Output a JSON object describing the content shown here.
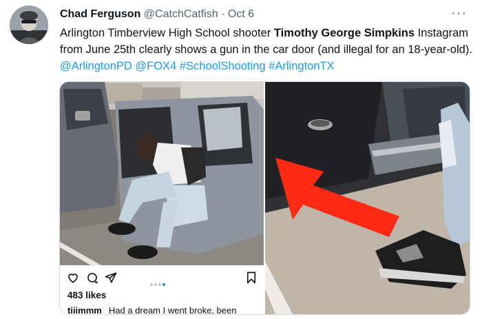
{
  "tweet": {
    "author_name": "Chad Ferguson",
    "author_handle": "@CatchCatfish",
    "separator": "·",
    "date": "Oct 6",
    "more_label": "···",
    "text_plain_1": "Arlington Timberview High School shooter ",
    "text_bold": "Timothy George Simpkins",
    "text_plain_2": " Instagram from June 25th clearly shows a gun in the car door (and illegal for an 18-year-old). ",
    "mentions": [
      "@ArlingtonPD",
      "@FOX4",
      "#SchoolShooting",
      "#ArlingtonTX"
    ]
  },
  "instagram": {
    "likes": "483 likes",
    "caption_user": "tiiimmm",
    "caption_text": "Had a dream I went broke, been",
    "carousel_active_index": 3,
    "carousel_count": 4
  },
  "icons": [
    "heart-icon",
    "comment-icon",
    "send-icon",
    "bookmark-icon",
    "more-icon"
  ],
  "colors": {
    "link": "#1d9bf0",
    "muted": "#536471",
    "arrow": "#ff2a14",
    "ig_dot_active": "#0095f6"
  }
}
